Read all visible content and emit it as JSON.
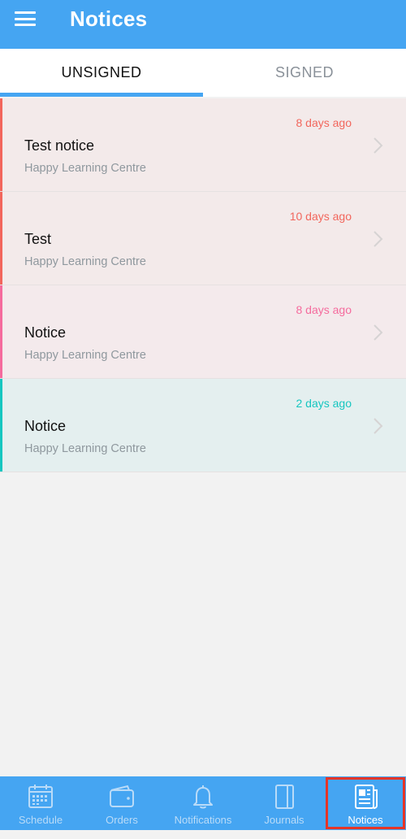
{
  "header": {
    "title": "Notices"
  },
  "tabs": [
    {
      "label": "UNSIGNED"
    },
    {
      "label": "SIGNED"
    }
  ],
  "notices": [
    {
      "title": "Test notice",
      "org": "Happy Learning Centre",
      "time": "8 days ago",
      "accent": "#f2665c",
      "bg": "#f3eaea",
      "time_color": "#f2665c"
    },
    {
      "title": "Test",
      "org": "Happy Learning Centre",
      "time": "10 days ago",
      "accent": "#f2665c",
      "bg": "#f3eaea",
      "time_color": "#f2665c"
    },
    {
      "title": "Notice",
      "org": "Happy Learning Centre",
      "time": "8 days ago",
      "accent": "#f56b9d",
      "bg": "#f4eaec",
      "time_color": "#f56b9d"
    },
    {
      "title": "Notice",
      "org": "Happy Learning Centre",
      "time": "2 days ago",
      "accent": "#16c6c0",
      "bg": "#e4efef",
      "time_color": "#16c6c0"
    }
  ],
  "bottom_nav": [
    {
      "label": "Schedule",
      "icon": "calendar-icon"
    },
    {
      "label": "Orders",
      "icon": "wallet-icon"
    },
    {
      "label": "Notifications",
      "icon": "bell-icon"
    },
    {
      "label": "Journals",
      "icon": "journal-icon"
    },
    {
      "label": "Notices",
      "icon": "newspaper-icon"
    }
  ],
  "colors": {
    "primary": "#45a5f2",
    "highlight_box": "#e53527"
  }
}
